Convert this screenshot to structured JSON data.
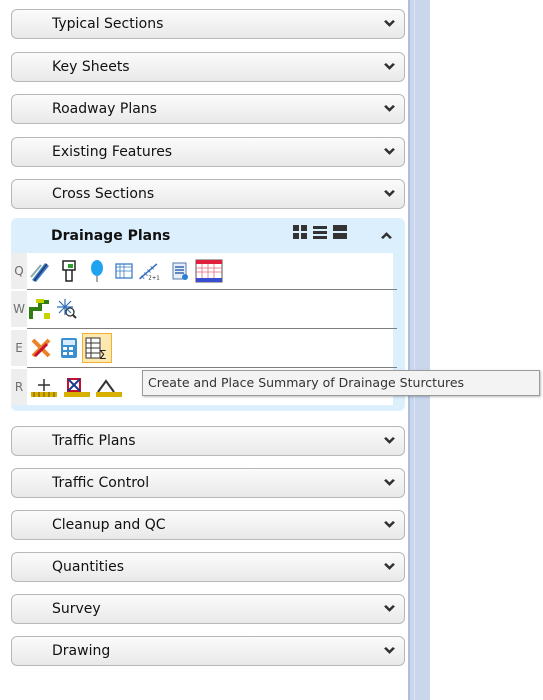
{
  "panels_top": [
    {
      "label": "Typical Sections"
    },
    {
      "label": "Key Sheets"
    },
    {
      "label": "Roadway Plans"
    },
    {
      "label": "Existing Features"
    },
    {
      "label": "Cross Sections"
    }
  ],
  "drainage": {
    "title": "Drainage Plans",
    "rows": [
      {
        "key": "Q"
      },
      {
        "key": "W"
      },
      {
        "key": "E"
      },
      {
        "key": "R"
      }
    ]
  },
  "tooltip": "Create and Place Summary of Drainage Sturctures",
  "panels_bottom": [
    {
      "label": "Traffic Plans"
    },
    {
      "label": "Traffic Control"
    },
    {
      "label": "Cleanup and QC"
    },
    {
      "label": "Quantities"
    },
    {
      "label": "Survey"
    },
    {
      "label": "Drawing"
    }
  ],
  "colors": {
    "expanded_header_bg": "#dceffd",
    "side_bar": "#c9d6ec",
    "tooltip_bg": "#f3f3f3"
  }
}
